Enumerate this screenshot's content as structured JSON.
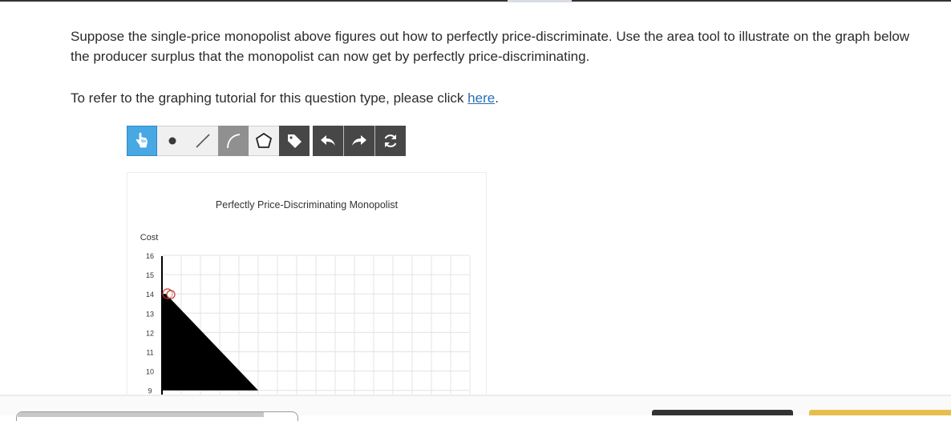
{
  "question": {
    "text": "Suppose the single-price monopolist above figures out how to perfectly price-discriminate. Use the area tool to illustrate on the graph below the producer surplus that the monopolist can now get by perfectly price-discriminating."
  },
  "tutorial": {
    "prefix": "To refer to the graphing tutorial for this question type, please click ",
    "link": "here",
    "suffix": "."
  },
  "toolbar": {
    "tools": [
      "select-tool",
      "point-tool",
      "line-tool",
      "curve-tool",
      "area-tool",
      "label-tool",
      "undo",
      "redo",
      "reset"
    ],
    "colors": {
      "select": "#47a8e3",
      "light": "#f0f0f0",
      "mid": "#909090",
      "dark": "#474747"
    }
  },
  "graph": {
    "title": "Perfectly Price-Discriminating Monopolist",
    "y_axis_label": "Cost",
    "y_ticks": [
      "16",
      "15",
      "14",
      "13",
      "12",
      "11",
      "10",
      "9"
    ],
    "fill_color": "#000000",
    "point_color": "#c0392b"
  },
  "chart_data": {
    "type": "area",
    "title": "Perfectly Price-Discriminating Monopolist",
    "ylabel": "Cost",
    "xlabel": "",
    "ylim": [
      9,
      16
    ],
    "y_ticks": [
      16,
      15,
      14,
      13,
      12,
      11,
      10,
      9
    ],
    "grid": true,
    "filled_area_vertices": [
      [
        0,
        14
      ],
      [
        0.2,
        14
      ],
      [
        5,
        9
      ],
      [
        0,
        9
      ]
    ]
  }
}
